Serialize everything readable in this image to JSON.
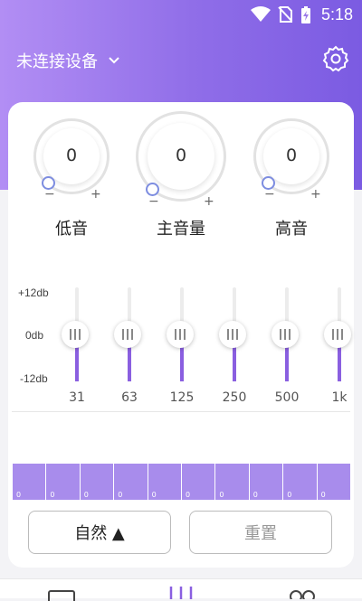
{
  "status_bar": {
    "time": "5:18"
  },
  "header": {
    "device_status": "未连接设备"
  },
  "knobs": [
    {
      "label": "低音",
      "value": "0",
      "minus": "−",
      "plus": "+"
    },
    {
      "label": "主音量",
      "value": "0",
      "minus": "−",
      "plus": "+"
    },
    {
      "label": "高音",
      "value": "0",
      "minus": "−",
      "plus": "+"
    }
  ],
  "equalizer": {
    "db_labels": [
      "+12db",
      "0db",
      "-12db"
    ],
    "bands": [
      {
        "freq": "31",
        "level": 0
      },
      {
        "freq": "63",
        "level": 0
      },
      {
        "freq": "125",
        "level": 0
      },
      {
        "freq": "250",
        "level": 0
      },
      {
        "freq": "500",
        "level": 0
      },
      {
        "freq": "1k",
        "level": 0
      }
    ]
  },
  "band_bars": [
    "0",
    "0",
    "0",
    "0",
    "0",
    "0",
    "0",
    "0",
    "0",
    "0"
  ],
  "buttons": {
    "preset": "自然 ▲",
    "reset": "重置"
  },
  "colors": {
    "accent": "#8a5fe0",
    "header_start": "#b28ef4",
    "header_end": "#7b5be2"
  }
}
